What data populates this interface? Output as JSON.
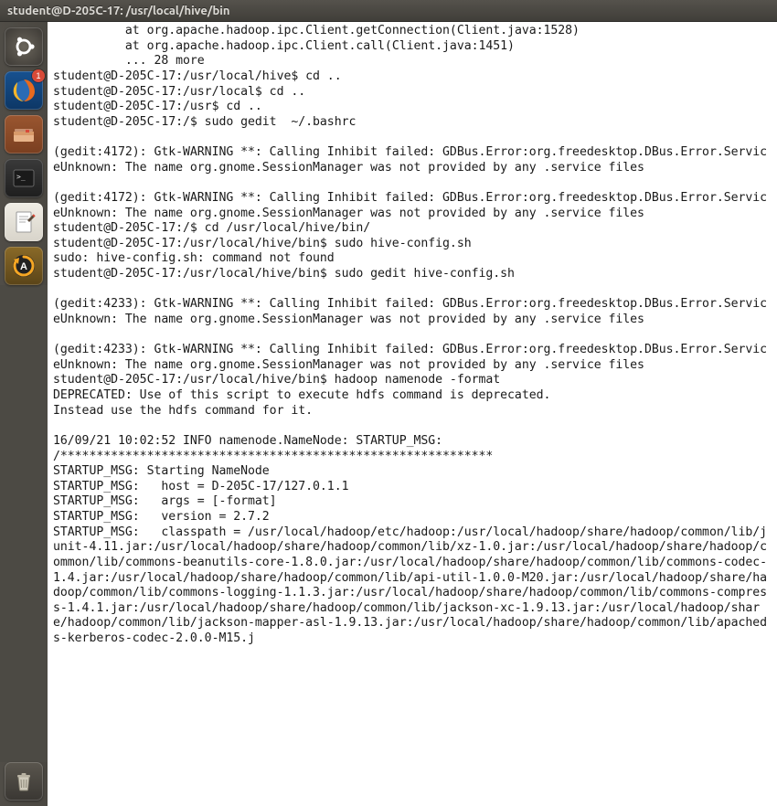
{
  "window": {
    "title": "student@D-205C-17: /usr/local/hive/bin"
  },
  "launcher": {
    "items": [
      {
        "name": "dash",
        "bg": "#3a3733"
      },
      {
        "name": "firefox",
        "bg": "#1a4a8a"
      },
      {
        "name": "files",
        "bg": "#8a4a2a"
      },
      {
        "name": "terminal",
        "bg": "#2b2b2b"
      },
      {
        "name": "text-editor",
        "bg": "#e8e5de"
      },
      {
        "name": "software-updater",
        "bg": "#7a5a20",
        "badge": "1"
      }
    ],
    "trash": {
      "name": "trash",
      "bg": "#3a3733"
    }
  },
  "terminal": {
    "lines": [
      "          at org.apache.hadoop.ipc.Client.getConnection(Client.java:1528)",
      "          at org.apache.hadoop.ipc.Client.call(Client.java:1451)",
      "          ... 28 more",
      "student@D-205C-17:/usr/local/hive$ cd ..",
      "student@D-205C-17:/usr/local$ cd ..",
      "student@D-205C-17:/usr$ cd ..",
      "student@D-205C-17:/$ sudo gedit  ~/.bashrc",
      "",
      "(gedit:4172): Gtk-WARNING **: Calling Inhibit failed: GDBus.Error:org.freedesktop.DBus.Error.ServiceUnknown: The name org.gnome.SessionManager was not provided by any .service files",
      "",
      "(gedit:4172): Gtk-WARNING **: Calling Inhibit failed: GDBus.Error:org.freedesktop.DBus.Error.ServiceUnknown: The name org.gnome.SessionManager was not provided by any .service files",
      "student@D-205C-17:/$ cd /usr/local/hive/bin/",
      "student@D-205C-17:/usr/local/hive/bin$ sudo hive-config.sh",
      "sudo: hive-config.sh: command not found",
      "student@D-205C-17:/usr/local/hive/bin$ sudo gedit hive-config.sh",
      "",
      "(gedit:4233): Gtk-WARNING **: Calling Inhibit failed: GDBus.Error:org.freedesktop.DBus.Error.ServiceUnknown: The name org.gnome.SessionManager was not provided by any .service files",
      "",
      "(gedit:4233): Gtk-WARNING **: Calling Inhibit failed: GDBus.Error:org.freedesktop.DBus.Error.ServiceUnknown: The name org.gnome.SessionManager was not provided by any .service files",
      "student@D-205C-17:/usr/local/hive/bin$ hadoop namenode -format",
      "DEPRECATED: Use of this script to execute hdfs command is deprecated.",
      "Instead use the hdfs command for it.",
      "",
      "16/09/21 10:02:52 INFO namenode.NameNode: STARTUP_MSG:",
      "/************************************************************",
      "STARTUP_MSG: Starting NameNode",
      "STARTUP_MSG:   host = D-205C-17/127.0.1.1",
      "STARTUP_MSG:   args = [-format]",
      "STARTUP_MSG:   version = 2.7.2",
      "STARTUP_MSG:   classpath = /usr/local/hadoop/etc/hadoop:/usr/local/hadoop/share/hadoop/common/lib/junit-4.11.jar:/usr/local/hadoop/share/hadoop/common/lib/xz-1.0.jar:/usr/local/hadoop/share/hadoop/common/lib/commons-beanutils-core-1.8.0.jar:/usr/local/hadoop/share/hadoop/common/lib/commons-codec-1.4.jar:/usr/local/hadoop/share/hadoop/common/lib/api-util-1.0.0-M20.jar:/usr/local/hadoop/share/hadoop/common/lib/commons-logging-1.1.3.jar:/usr/local/hadoop/share/hadoop/common/lib/commons-compress-1.4.1.jar:/usr/local/hadoop/share/hadoop/common/lib/jackson-xc-1.9.13.jar:/usr/local/hadoop/share/hadoop/common/lib/jackson-mapper-asl-1.9.13.jar:/usr/local/hadoop/share/hadoop/common/lib/apacheds-kerberos-codec-2.0.0-M15.j"
    ]
  }
}
